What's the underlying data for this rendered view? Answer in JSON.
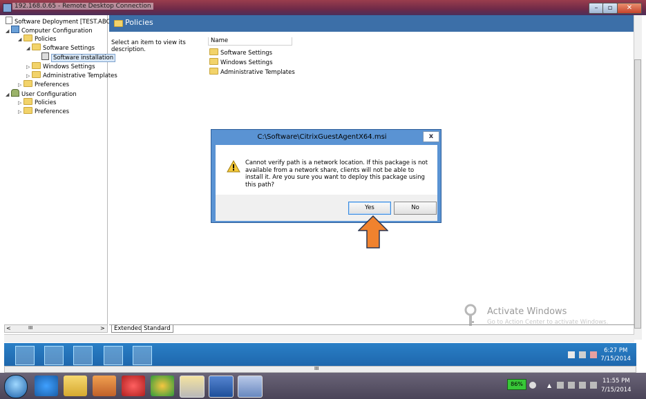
{
  "window": {
    "title": "192.168.0.65 - Remote Desktop Connection"
  },
  "tree": {
    "root": "Software Deployment [TEST.ABC.CC",
    "computer_config": "Computer Configuration",
    "policies": "Policies",
    "software_settings": "Software Settings",
    "software_installation": "Software installation",
    "windows_settings": "Windows Settings",
    "admin_templates": "Administrative Templates",
    "preferences": "Preferences",
    "user_config": "User Configuration",
    "user_policies": "Policies",
    "user_preferences": "Preferences"
  },
  "header": {
    "title": "Policies"
  },
  "main": {
    "description": "Select an item to view its description.",
    "column_name": "Name",
    "items": [
      "Software Settings",
      "Windows Settings",
      "Administrative Templates"
    ]
  },
  "tabs": {
    "extended": "Extended",
    "standard": "Standard"
  },
  "dialog": {
    "title": "C:\\Software\\CitrixGuestAgentX64.msi",
    "close": "x",
    "message": "Cannot verify path is a network location.  If this package is not available from a network share, clients will not be able to install it.  Are you sure you want to deploy this package using this path?",
    "yes": "Yes",
    "no": "No"
  },
  "activation": {
    "title": "Activate Windows",
    "subtitle": "Go to Action Center to activate Windows."
  },
  "inner_clock": {
    "time": "6:27 PM",
    "date": "7/15/2014"
  },
  "host_clock": {
    "time": "11:55 PM",
    "date": "7/15/2014"
  },
  "battery": {
    "level": "86%"
  },
  "scrollbar": {
    "left_grip": "III",
    "bottom_grip": "III"
  },
  "colors": {
    "header": "#3c6fa8",
    "taskbar": "#1e67ad",
    "dialog_frame": "#5a93d3",
    "arrow": "#f0822e"
  }
}
